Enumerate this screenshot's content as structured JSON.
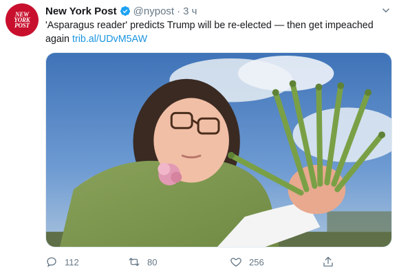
{
  "account": {
    "name": "New York Post",
    "handle": "@nypost",
    "time": "3 ч",
    "logo_text": [
      "NEW",
      "YORK",
      "POST"
    ]
  },
  "tweet": {
    "text": "'Asparagus reader' predicts Trump will be re-elected — then get impeached again",
    "link": "trib.al/UDvM5AW"
  },
  "stats": {
    "replies": "112",
    "retweets": "80",
    "likes": "256"
  },
  "colors": {
    "brand_red": "#c8102e",
    "verified_blue": "#1da1f2",
    "link_blue": "#1b95e0",
    "muted_gray": "#657786"
  },
  "icons": {
    "verified": "verified-badge-icon",
    "more": "chevron-down-icon",
    "reply": "reply-icon",
    "retweet": "retweet-icon",
    "like": "heart-icon",
    "share": "share-icon"
  }
}
